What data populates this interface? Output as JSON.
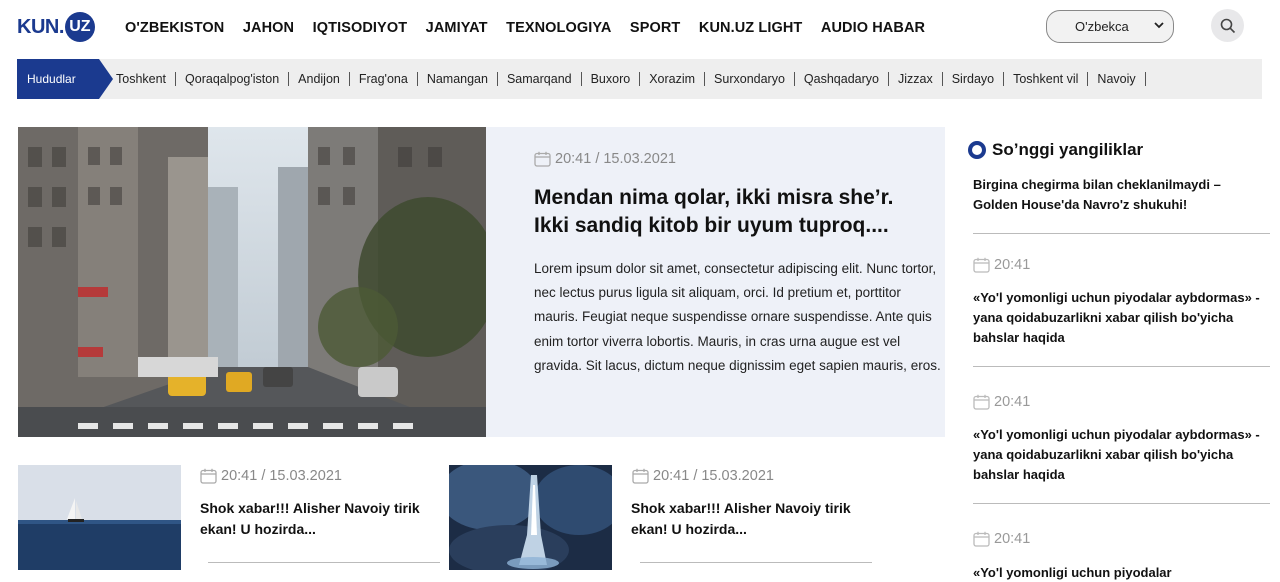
{
  "header": {
    "logo_text": "KUN.",
    "logo_badge": "UZ",
    "nav": [
      "O'ZBEKISTON",
      "JAHON",
      "IQTISODIYOT",
      "JAMIYAT",
      "TEXNOLOGIYA",
      "SPORT",
      "KUN.UZ LIGHT",
      "AUDIO HABAR"
    ],
    "language": "O'zbekca",
    "search_icon": "search-icon"
  },
  "regions": {
    "label": "Hududlar",
    "items": [
      "Toshkent",
      "Qoraqalpog'iston",
      "Andijon",
      "Frag'ona",
      "Namangan",
      "Samarqand",
      "Buxoro",
      "Xorazim",
      "Surxondaryo",
      "Qashqadaryo",
      "Jizzax",
      "Sirdayo",
      "Toshkent vil",
      "Navoiy"
    ]
  },
  "hero": {
    "date": "20:41 / 15.03.2021",
    "title": "Mendan nima qolar, ikki misra she’r. Ikki sandiq kitob bir uyum tuproq....",
    "text": "Lorem ipsum dolor sit amet, consectetur adipiscing elit. Nunc tortor, nec lectus purus ligula sit aliquam, orci. Id pretium et, porttitor mauris. Feugiat neque suspendisse ornare suspendisse. Ante quis enim tortor viverra lobortis. Mauris, in cras urna augue est vel gravida. Sit lacus, dictum neque dignissim eget sapien mauris, eros."
  },
  "cards": [
    {
      "date": "20:41 / 15.03.2021",
      "title": "Shok xabar!!! Alisher Navoiy tirik ekan! U hozirda..."
    },
    {
      "date": "20:41 / 15.03.2021",
      "title": "Shok xabar!!! Alisher Navoiy tirik ekan! U hozirda..."
    }
  ],
  "sidebar": {
    "heading": "So’nggi yangiliklar",
    "first_title": "Birgina chegirma bilan cheklanilmaydi – Golden House'da Navro'z shukuhi!",
    "items": [
      {
        "time": "20:41",
        "title": "«Yo'l yomonligi uchun piyodalar aybdormas» - yana qoidabuzarlikni xabar qilish bo'yicha bahslar haqida"
      },
      {
        "time": "20:41",
        "title": "«Yo'l yomonligi uchun piyodalar aybdormas» - yana qoidabuzarlikni xabar qilish bo'yicha bahslar haqida"
      },
      {
        "time": "20:41",
        "title": "«Yo'l yomonligi uchun piyodalar"
      }
    ]
  },
  "colors": {
    "brand": "#1b3a8f",
    "hero_panel": "#eef1f8",
    "regions_bar": "#eeeeee"
  }
}
